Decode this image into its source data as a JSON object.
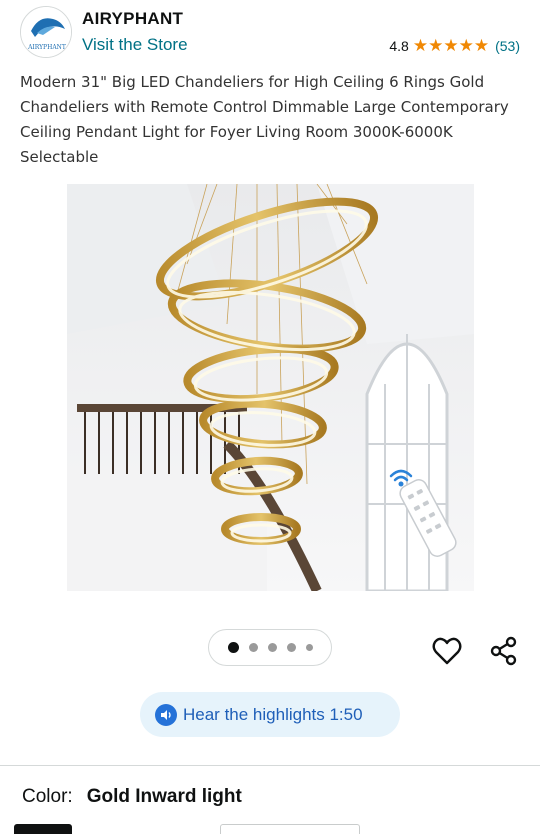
{
  "store": {
    "logo_text": "AIRYPHANT",
    "name": "AIRYPHANT",
    "link_label": "Visit the Store",
    "rating": "4.8",
    "rating_count": "(53)",
    "stars": 5
  },
  "product": {
    "title": "Modern 31\" Big LED Chandeliers for High Ceiling 6 Rings Gold Chandeliers with Remote Control Dimmable Large Contemporary Ceiling Pendant Light for Foyer Living Room 3000K-6000K Selectable",
    "image_icon": "chandelier-photo"
  },
  "carousel": {
    "total_dots": 5,
    "active_index": 0
  },
  "actions": {
    "wishlist_icon": "heart-icon",
    "share_icon": "share-icon"
  },
  "highlights": {
    "label": "Hear the highlights 1:50"
  },
  "variation": {
    "label": "Color:",
    "value": "Gold Inward light"
  },
  "colors": {
    "link": "#007185",
    "star": "#f08804",
    "highlight_bg": "#e6f3fb",
    "highlight_text": "#1f5fb8"
  }
}
